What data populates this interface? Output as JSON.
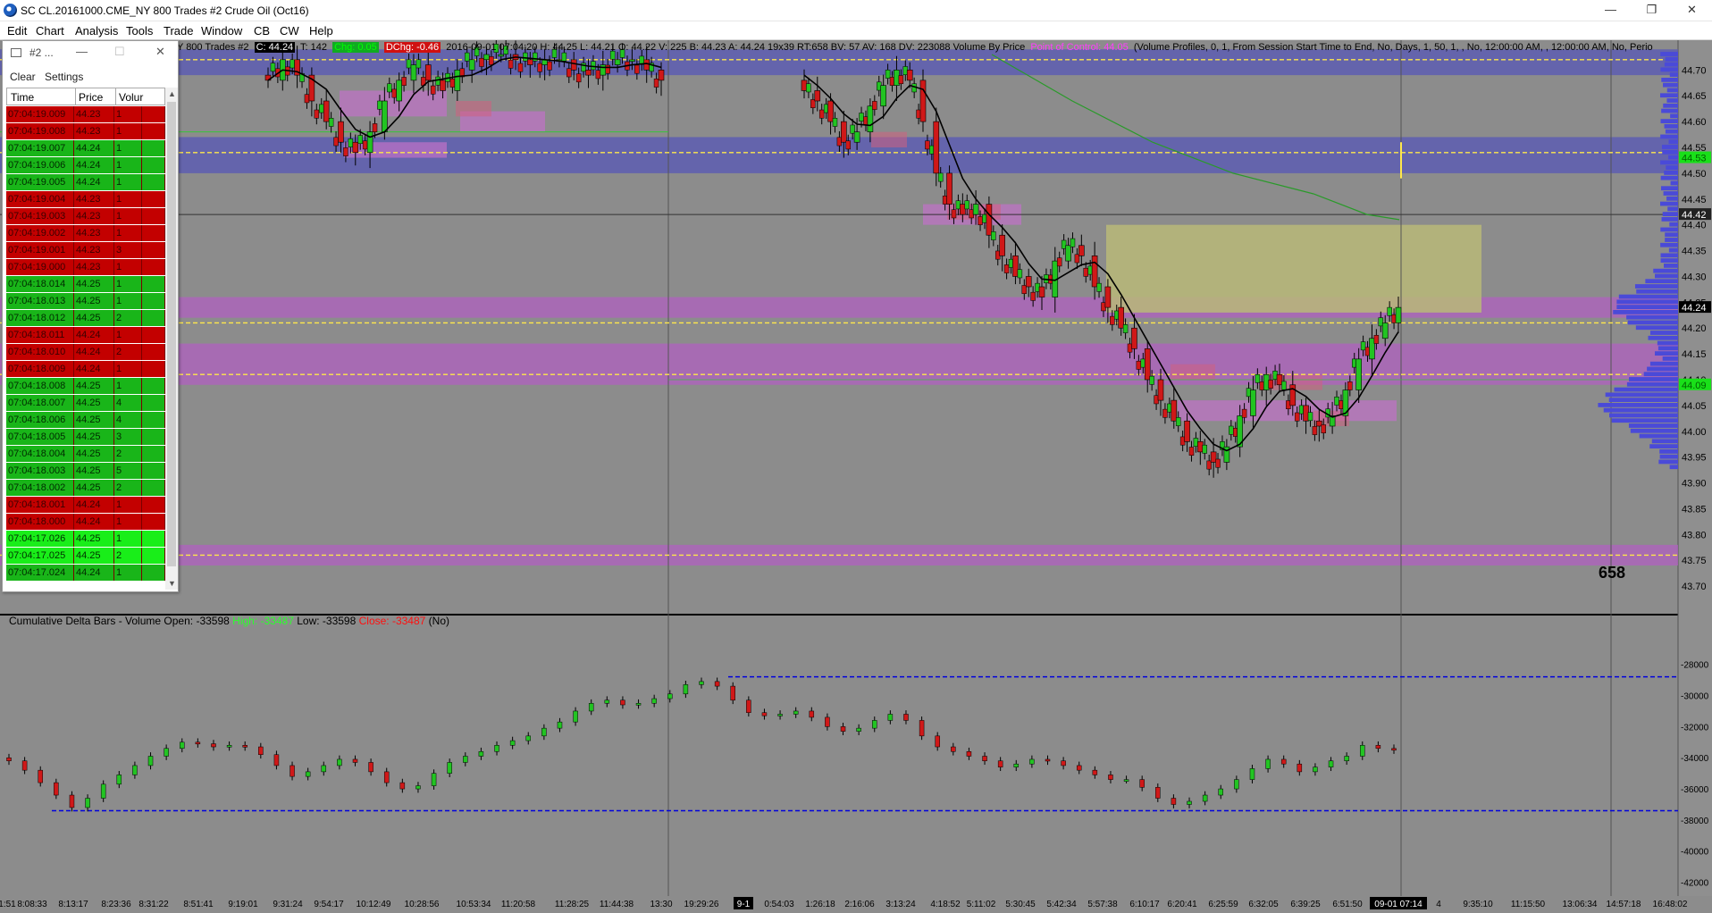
{
  "window": {
    "title": "SC CL.20161000.CME_NY  800 Trades  #2  Crude Oil (Oct16)",
    "controls": {
      "minimize": "—",
      "restore": "❐",
      "close": "✕"
    }
  },
  "menu": [
    "Edit",
    "Chart",
    "Analysis",
    "Tools",
    "Trade",
    "Window",
    "CB",
    "CW",
    "Help"
  ],
  "chart_header": {
    "prefix": "Y  800 Trades  #2",
    "close": "C: 44.24",
    "trades": "T: 142",
    "change": "Chg: 0.05",
    "dchange": "DChg: -0.46",
    "bar_info": "2016-09-01 07:04:20  H: 44.25  L: 44.21  O: 44.22  V: 225  B: 44.23  A: 44.24  19x39  RT:658  BV: 57  AV: 168  DV: 223088  Volume By Price",
    "poc": "Point of Control: 44.05",
    "study": "(Volume Profiles, 0, 1, From Session Start Time to End, No, Days, 1, 50, 1, , No, 12:00:00 AM, , 12:00:00 AM, No, Perio"
  },
  "time_and_sales": {
    "title": "#2 ...",
    "toolbar": {
      "clear": "Clear",
      "settings": "Settings"
    },
    "columns": [
      "Time",
      "Price",
      "Volur"
    ],
    "rows": [
      {
        "time": "07:04:19.009",
        "price": "44.23",
        "vol": "1",
        "side": "red"
      },
      {
        "time": "07:04:19.008",
        "price": "44.23",
        "vol": "1",
        "side": "red"
      },
      {
        "time": "07:04:19.007",
        "price": "44.24",
        "vol": "1",
        "side": "green"
      },
      {
        "time": "07:04:19.006",
        "price": "44.24",
        "vol": "1",
        "side": "green"
      },
      {
        "time": "07:04:19.005",
        "price": "44.24",
        "vol": "1",
        "side": "green"
      },
      {
        "time": "07:04:19.004",
        "price": "44.23",
        "vol": "1",
        "side": "red"
      },
      {
        "time": "07:04:19.003",
        "price": "44.23",
        "vol": "1",
        "side": "red"
      },
      {
        "time": "07:04:19.002",
        "price": "44.23",
        "vol": "1",
        "side": "red"
      },
      {
        "time": "07:04:19.001",
        "price": "44.23",
        "vol": "3",
        "side": "red"
      },
      {
        "time": "07:04:19.000",
        "price": "44.23",
        "vol": "1",
        "side": "red"
      },
      {
        "time": "07:04:18.014",
        "price": "44.25",
        "vol": "1",
        "side": "green"
      },
      {
        "time": "07:04:18.013",
        "price": "44.25",
        "vol": "1",
        "side": "green"
      },
      {
        "time": "07:04:18.012",
        "price": "44.25",
        "vol": "2",
        "side": "green"
      },
      {
        "time": "07:04:18.011",
        "price": "44.24",
        "vol": "1",
        "side": "red"
      },
      {
        "time": "07:04:18.010",
        "price": "44.24",
        "vol": "2",
        "side": "red"
      },
      {
        "time": "07:04:18.009",
        "price": "44.24",
        "vol": "1",
        "side": "red"
      },
      {
        "time": "07:04:18.008",
        "price": "44.25",
        "vol": "1",
        "side": "green"
      },
      {
        "time": "07:04:18.007",
        "price": "44.25",
        "vol": "4",
        "side": "green"
      },
      {
        "time": "07:04:18.006",
        "price": "44.25",
        "vol": "4",
        "side": "green"
      },
      {
        "time": "07:04:18.005",
        "price": "44.25",
        "vol": "3",
        "side": "green"
      },
      {
        "time": "07:04:18.004",
        "price": "44.25",
        "vol": "2",
        "side": "green"
      },
      {
        "time": "07:04:18.003",
        "price": "44.25",
        "vol": "5",
        "side": "green"
      },
      {
        "time": "07:04:18.002",
        "price": "44.25",
        "vol": "2",
        "side": "green"
      },
      {
        "time": "07:04:18.001",
        "price": "44.24",
        "vol": "1",
        "side": "red"
      },
      {
        "time": "07:04:18.000",
        "price": "44.24",
        "vol": "1",
        "side": "red"
      },
      {
        "time": "07:04:17.026",
        "price": "44.25",
        "vol": "1",
        "side": "lime"
      },
      {
        "time": "07:04:17.025",
        "price": "44.25",
        "vol": "2",
        "side": "lime"
      },
      {
        "time": "07:04:17.024",
        "price": "44.24",
        "vol": "1",
        "side": "green"
      }
    ]
  },
  "price_axis": {
    "ticks": [
      "44.70",
      "44.65",
      "44.60",
      "44.55",
      "44.50",
      "44.45",
      "44.40",
      "44.35",
      "44.30",
      "44.25",
      "44.20",
      "44.15",
      "44.10",
      "44.05",
      "44.00",
      "43.95",
      "43.90",
      "43.85",
      "43.80",
      "43.75",
      "43.70"
    ],
    "last_price_label": "44.24",
    "crosshair_label": "44.42",
    "green_labels": [
      "44.53",
      "44.09"
    ]
  },
  "delta_axis": {
    "ticks": [
      "-28000",
      "-30000",
      "-32000",
      "-34000",
      "-36000",
      "-38000",
      "-40000",
      "-42000"
    ]
  },
  "subgraph": {
    "label": "Cumulative Delta Bars - Volume",
    "open": "Open: -33598",
    "high": "High: -33487",
    "low": "Low: -33598",
    "close": "Close: -33487",
    "suffix": "(No)"
  },
  "big_counter": "658",
  "time_axis": {
    "labels": [
      "1:51",
      "8:08:33",
      "8:13:17",
      "8:23:36",
      "8:31:22",
      "8:51:41",
      "9:19:01",
      "9:31:24",
      "9:54:17",
      "10:12:49",
      "10:28:56",
      "10:53:34",
      "11:20:58",
      "11:28:25",
      "11:44:38",
      "13:30",
      "19:29:26",
      "9-1",
      "0:54:03",
      "1:26:18",
      "2:16:06",
      "3:13:24",
      "4:18:52",
      "5:11:02",
      "5:30:45",
      "5:42:34",
      "5:57:38",
      "6:10:17",
      "6:20:41",
      "6:25:59",
      "6:32:05",
      "6:39:25",
      "6:51:50",
      "09-01 07:14",
      "4",
      "9:35:10",
      "11:15:50",
      "13:06:34",
      "14:57:18",
      "16:48:02"
    ]
  },
  "colors": {
    "background": "#8c8c8c",
    "volume_profile": "#4a4ad8",
    "value_area_band": "#5a5ab4",
    "hvn_band": "#b060c0",
    "supply_zone": "#b8b878",
    "ma_line": "#000000",
    "long_ma": "#2a9a2a",
    "level_line": "#ffe84a",
    "delta_range": "#0000dd"
  },
  "chart_data": {
    "type": "candlestick",
    "symbol": "SC CL.20161000.CME_NY",
    "bar_size": "800 Trades",
    "price_ylim": [
      43.65,
      44.73
    ],
    "delta_ylim": [
      -43000,
      -27500
    ],
    "horizontal_levels": [
      44.72,
      44.54,
      44.21,
      44.11,
      43.76
    ],
    "bands": [
      {
        "from": 44.69,
        "to": 44.74,
        "kind": "value-area"
      },
      {
        "from": 44.5,
        "to": 44.57,
        "kind": "value-area"
      },
      {
        "from": 44.22,
        "to": 44.26,
        "kind": "hvn"
      },
      {
        "from": 44.09,
        "to": 44.17,
        "kind": "hvn"
      },
      {
        "from": 43.74,
        "to": 43.78,
        "kind": "hvn"
      }
    ],
    "supply_zone": {
      "from": 44.23,
      "to": 44.4
    },
    "price_path": [
      44.68,
      44.72,
      44.69,
      44.64,
      44.6,
      44.56,
      44.54,
      44.58,
      44.64,
      44.68,
      44.71,
      44.68,
      44.66,
      44.7,
      44.72,
      44.73,
      44.73,
      44.72,
      44.71,
      44.72,
      44.72,
      44.7,
      44.69,
      44.71,
      44.72,
      44.72,
      44.7,
      44.68,
      44.66,
      44.64,
      44.6,
      44.56,
      44.58,
      44.63,
      44.67,
      44.7,
      44.68,
      44.6,
      44.5,
      44.44,
      44.42,
      44.44,
      44.38,
      44.34,
      44.3,
      44.28,
      44.26,
      44.33,
      44.36,
      44.34,
      44.28,
      44.24,
      44.2,
      44.16,
      44.1,
      44.06,
      44.02,
      43.98,
      43.96,
      43.94,
      43.97,
      44.03,
      44.08,
      44.11,
      44.09,
      44.05,
      44.02,
      44.01,
      44.03,
      44.08,
      44.14,
      44.18,
      44.21,
      44.24
    ],
    "delta_path": [
      -34200,
      -34800,
      -35600,
      -36400,
      -37200,
      -36600,
      -35700,
      -35100,
      -34500,
      -33900,
      -33400,
      -33000,
      -33100,
      -33300,
      -33200,
      -33300,
      -33800,
      -34500,
      -35200,
      -34900,
      -34500,
      -34100,
      -34300,
      -34900,
      -35600,
      -36000,
      -35800,
      -35000,
      -34300,
      -33900,
      -33600,
      -33200,
      -32900,
      -32600,
      -32100,
      -31700,
      -31000,
      -30500,
      -30300,
      -30600,
      -30500,
      -30200,
      -29900,
      -29300,
      -29100,
      -29400,
      -30300,
      -31100,
      -31300,
      -31200,
      -31000,
      -31400,
      -32000,
      -32300,
      -32100,
      -31600,
      -31200,
      -31600,
      -32600,
      -33300,
      -33600,
      -33900,
      -34200,
      -34600,
      -34400,
      -34100,
      -34200,
      -34500,
      -34800,
      -35100,
      -35400,
      -35400,
      -35900,
      -36600,
      -37000,
      -36800,
      -36400,
      -36000,
      -35400,
      -34700,
      -34100,
      -34400,
      -34900,
      -34600,
      -34200,
      -33900,
      -33200,
      -33400,
      -33500
    ]
  }
}
